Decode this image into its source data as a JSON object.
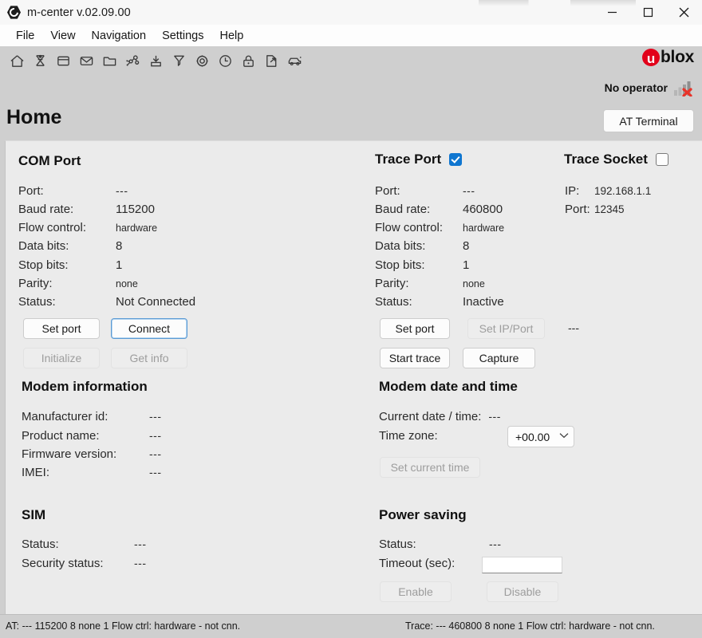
{
  "window": {
    "title": "m-center v.02.09.00",
    "app_icon": "m-center-logo-icon",
    "minimize_label": "Minimize",
    "maximize_label": "Maximize",
    "close_label": "Close"
  },
  "menubar": {
    "items": [
      {
        "label": "File"
      },
      {
        "label": "View"
      },
      {
        "label": "Navigation"
      },
      {
        "label": "Settings"
      },
      {
        "label": "Help"
      }
    ]
  },
  "toolbar": {
    "icons": [
      {
        "name": "home-icon"
      },
      {
        "name": "antenna-tower-icon"
      },
      {
        "name": "window-icon"
      },
      {
        "name": "mail-icon"
      },
      {
        "name": "folder-icon"
      },
      {
        "name": "network-nodes-icon"
      },
      {
        "name": "download-icon"
      },
      {
        "name": "funnel-filter-icon"
      },
      {
        "name": "gear-icon"
      },
      {
        "name": "clock-icon"
      },
      {
        "name": "lock-icon"
      },
      {
        "name": "file-export-icon"
      },
      {
        "name": "car-icon"
      }
    ]
  },
  "brand": {
    "logo_u": "u",
    "logo_text": "blox",
    "operator_status": "No operator",
    "signal_icon": "signal-bars-error-icon"
  },
  "page": {
    "title": "Home",
    "at_terminal_button": "AT Terminal"
  },
  "com_port": {
    "title": "COM Port",
    "rows": [
      {
        "label": "Port:",
        "value": "---",
        "style": "dash"
      },
      {
        "label": "Baud rate:",
        "value": "115200",
        "style": "normal"
      },
      {
        "label": "Flow control:",
        "value": "hardware",
        "style": "small"
      },
      {
        "label": "Data bits:",
        "value": "8",
        "style": "normal"
      },
      {
        "label": "Stop bits:",
        "value": "1",
        "style": "normal"
      },
      {
        "label": "Parity:",
        "value": "none",
        "style": "small"
      },
      {
        "label": "Status:",
        "value": "Not Connected",
        "style": "normal"
      }
    ],
    "buttons": {
      "set_port": "Set port",
      "connect": "Connect",
      "initialize": "Initialize",
      "get_info": "Get info"
    }
  },
  "trace_port": {
    "title": "Trace Port",
    "enabled": true,
    "rows": [
      {
        "label": "Port:",
        "value": "---",
        "style": "dash"
      },
      {
        "label": "Baud rate:",
        "value": "460800",
        "style": "normal"
      },
      {
        "label": "Flow control:",
        "value": "hardware",
        "style": "small"
      },
      {
        "label": "Data bits:",
        "value": "8",
        "style": "normal"
      },
      {
        "label": "Stop bits:",
        "value": "1",
        "style": "normal"
      },
      {
        "label": "Parity:",
        "value": "none",
        "style": "small"
      },
      {
        "label": "Status:",
        "value": "Inactive",
        "style": "normal"
      }
    ],
    "buttons": {
      "set_port": "Set port",
      "start_trace": "Start trace",
      "capture": "Capture"
    }
  },
  "trace_socket": {
    "title": "Trace Socket",
    "enabled": false,
    "rows": [
      {
        "label": "IP:",
        "value": "192.168.1.1"
      },
      {
        "label": "Port:",
        "value": "12345"
      }
    ],
    "set_ip_port_button": "Set IP/Port",
    "status_value": "---"
  },
  "modem_information": {
    "title": "Modem information",
    "rows": [
      {
        "label": "Manufacturer id:",
        "value": "---"
      },
      {
        "label": "Product name:",
        "value": "---"
      },
      {
        "label": "Firmware version:",
        "value": "---"
      },
      {
        "label": "IMEI:",
        "value": "---"
      }
    ]
  },
  "modem_date_time": {
    "title": "Modem date and time",
    "current_label": "Current date / time:",
    "current_value": "---",
    "timezone_label": "Time zone:",
    "timezone_value": "+00.00",
    "set_current_time_button": "Set current time"
  },
  "sim": {
    "title": "SIM",
    "rows": [
      {
        "label": "Status:",
        "value": "---"
      },
      {
        "label": "Security status:",
        "value": "---"
      }
    ]
  },
  "power_saving": {
    "title": "Power saving",
    "status_label": "Status:",
    "status_value": "---",
    "timeout_label": "Timeout (sec):",
    "timeout_value": "",
    "timeout_placeholder": "",
    "enable_button": "Enable",
    "disable_button": "Disable"
  },
  "statusbar": {
    "at": "AT: --- 115200 8 none 1 Flow ctrl: hardware - not cnn.",
    "trace": "Trace: --- 460800 8 none 1 Flow ctrl: hardware - not cnn."
  },
  "colors": {
    "accent_blue": "#0f76d0",
    "brand_red": "#e2001a",
    "window_chrome": "#f7f7f7",
    "toolbar_bg": "#cfcfcf",
    "content_bg": "#ebebeb"
  }
}
